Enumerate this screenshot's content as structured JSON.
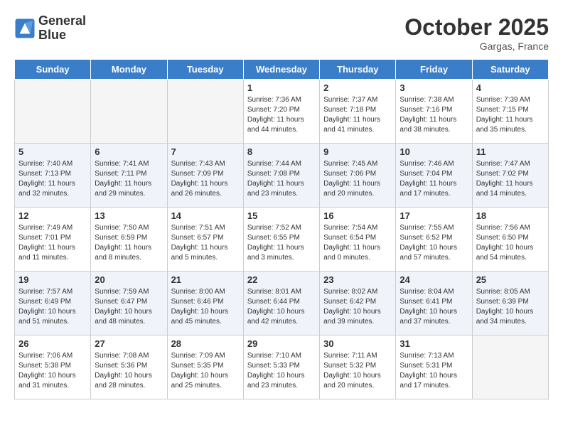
{
  "logo": {
    "line1": "General",
    "line2": "Blue"
  },
  "title": "October 2025",
  "location": "Gargas, France",
  "weekdays": [
    "Sunday",
    "Monday",
    "Tuesday",
    "Wednesday",
    "Thursday",
    "Friday",
    "Saturday"
  ],
  "weeks": [
    [
      {
        "day": "",
        "sunrise": "",
        "sunset": "",
        "daylight": ""
      },
      {
        "day": "",
        "sunrise": "",
        "sunset": "",
        "daylight": ""
      },
      {
        "day": "",
        "sunrise": "",
        "sunset": "",
        "daylight": ""
      },
      {
        "day": "1",
        "sunrise": "Sunrise: 7:36 AM",
        "sunset": "Sunset: 7:20 PM",
        "daylight": "Daylight: 11 hours and 44 minutes."
      },
      {
        "day": "2",
        "sunrise": "Sunrise: 7:37 AM",
        "sunset": "Sunset: 7:18 PM",
        "daylight": "Daylight: 11 hours and 41 minutes."
      },
      {
        "day": "3",
        "sunrise": "Sunrise: 7:38 AM",
        "sunset": "Sunset: 7:16 PM",
        "daylight": "Daylight: 11 hours and 38 minutes."
      },
      {
        "day": "4",
        "sunrise": "Sunrise: 7:39 AM",
        "sunset": "Sunset: 7:15 PM",
        "daylight": "Daylight: 11 hours and 35 minutes."
      }
    ],
    [
      {
        "day": "5",
        "sunrise": "Sunrise: 7:40 AM",
        "sunset": "Sunset: 7:13 PM",
        "daylight": "Daylight: 11 hours and 32 minutes."
      },
      {
        "day": "6",
        "sunrise": "Sunrise: 7:41 AM",
        "sunset": "Sunset: 7:11 PM",
        "daylight": "Daylight: 11 hours and 29 minutes."
      },
      {
        "day": "7",
        "sunrise": "Sunrise: 7:43 AM",
        "sunset": "Sunset: 7:09 PM",
        "daylight": "Daylight: 11 hours and 26 minutes."
      },
      {
        "day": "8",
        "sunrise": "Sunrise: 7:44 AM",
        "sunset": "Sunset: 7:08 PM",
        "daylight": "Daylight: 11 hours and 23 minutes."
      },
      {
        "day": "9",
        "sunrise": "Sunrise: 7:45 AM",
        "sunset": "Sunset: 7:06 PM",
        "daylight": "Daylight: 11 hours and 20 minutes."
      },
      {
        "day": "10",
        "sunrise": "Sunrise: 7:46 AM",
        "sunset": "Sunset: 7:04 PM",
        "daylight": "Daylight: 11 hours and 17 minutes."
      },
      {
        "day": "11",
        "sunrise": "Sunrise: 7:47 AM",
        "sunset": "Sunset: 7:02 PM",
        "daylight": "Daylight: 11 hours and 14 minutes."
      }
    ],
    [
      {
        "day": "12",
        "sunrise": "Sunrise: 7:49 AM",
        "sunset": "Sunset: 7:01 PM",
        "daylight": "Daylight: 11 hours and 11 minutes."
      },
      {
        "day": "13",
        "sunrise": "Sunrise: 7:50 AM",
        "sunset": "Sunset: 6:59 PM",
        "daylight": "Daylight: 11 hours and 8 minutes."
      },
      {
        "day": "14",
        "sunrise": "Sunrise: 7:51 AM",
        "sunset": "Sunset: 6:57 PM",
        "daylight": "Daylight: 11 hours and 5 minutes."
      },
      {
        "day": "15",
        "sunrise": "Sunrise: 7:52 AM",
        "sunset": "Sunset: 6:55 PM",
        "daylight": "Daylight: 11 hours and 3 minutes."
      },
      {
        "day": "16",
        "sunrise": "Sunrise: 7:54 AM",
        "sunset": "Sunset: 6:54 PM",
        "daylight": "Daylight: 11 hours and 0 minutes."
      },
      {
        "day": "17",
        "sunrise": "Sunrise: 7:55 AM",
        "sunset": "Sunset: 6:52 PM",
        "daylight": "Daylight: 10 hours and 57 minutes."
      },
      {
        "day": "18",
        "sunrise": "Sunrise: 7:56 AM",
        "sunset": "Sunset: 6:50 PM",
        "daylight": "Daylight: 10 hours and 54 minutes."
      }
    ],
    [
      {
        "day": "19",
        "sunrise": "Sunrise: 7:57 AM",
        "sunset": "Sunset: 6:49 PM",
        "daylight": "Daylight: 10 hours and 51 minutes."
      },
      {
        "day": "20",
        "sunrise": "Sunrise: 7:59 AM",
        "sunset": "Sunset: 6:47 PM",
        "daylight": "Daylight: 10 hours and 48 minutes."
      },
      {
        "day": "21",
        "sunrise": "Sunrise: 8:00 AM",
        "sunset": "Sunset: 6:46 PM",
        "daylight": "Daylight: 10 hours and 45 minutes."
      },
      {
        "day": "22",
        "sunrise": "Sunrise: 8:01 AM",
        "sunset": "Sunset: 6:44 PM",
        "daylight": "Daylight: 10 hours and 42 minutes."
      },
      {
        "day": "23",
        "sunrise": "Sunrise: 8:02 AM",
        "sunset": "Sunset: 6:42 PM",
        "daylight": "Daylight: 10 hours and 39 minutes."
      },
      {
        "day": "24",
        "sunrise": "Sunrise: 8:04 AM",
        "sunset": "Sunset: 6:41 PM",
        "daylight": "Daylight: 10 hours and 37 minutes."
      },
      {
        "day": "25",
        "sunrise": "Sunrise: 8:05 AM",
        "sunset": "Sunset: 6:39 PM",
        "daylight": "Daylight: 10 hours and 34 minutes."
      }
    ],
    [
      {
        "day": "26",
        "sunrise": "Sunrise: 7:06 AM",
        "sunset": "Sunset: 5:38 PM",
        "daylight": "Daylight: 10 hours and 31 minutes."
      },
      {
        "day": "27",
        "sunrise": "Sunrise: 7:08 AM",
        "sunset": "Sunset: 5:36 PM",
        "daylight": "Daylight: 10 hours and 28 minutes."
      },
      {
        "day": "28",
        "sunrise": "Sunrise: 7:09 AM",
        "sunset": "Sunset: 5:35 PM",
        "daylight": "Daylight: 10 hours and 25 minutes."
      },
      {
        "day": "29",
        "sunrise": "Sunrise: 7:10 AM",
        "sunset": "Sunset: 5:33 PM",
        "daylight": "Daylight: 10 hours and 23 minutes."
      },
      {
        "day": "30",
        "sunrise": "Sunrise: 7:11 AM",
        "sunset": "Sunset: 5:32 PM",
        "daylight": "Daylight: 10 hours and 20 minutes."
      },
      {
        "day": "31",
        "sunrise": "Sunrise: 7:13 AM",
        "sunset": "Sunset: 5:31 PM",
        "daylight": "Daylight: 10 hours and 17 minutes."
      },
      {
        "day": "",
        "sunrise": "",
        "sunset": "",
        "daylight": ""
      }
    ]
  ]
}
